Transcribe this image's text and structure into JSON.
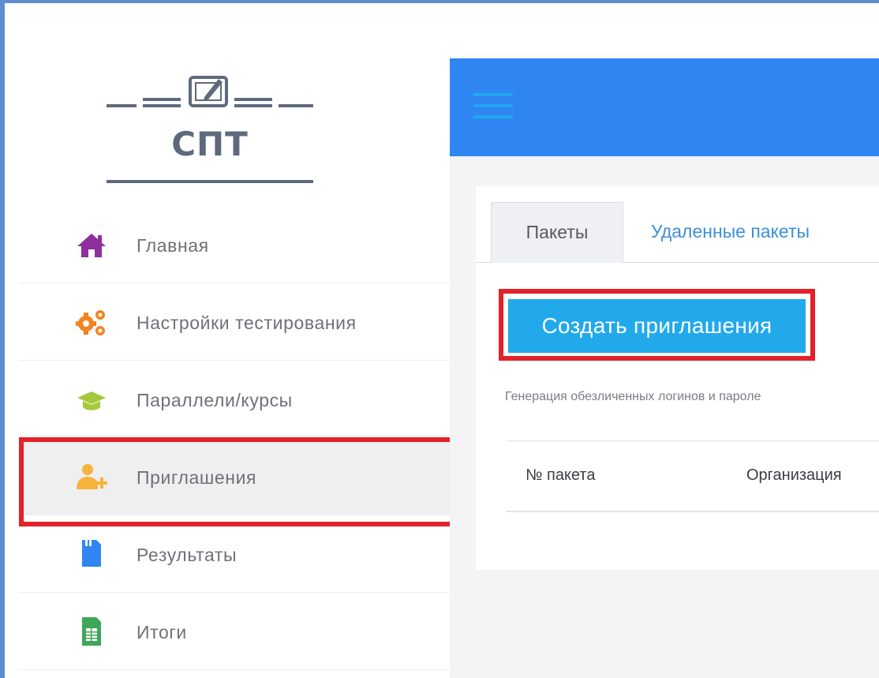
{
  "logo": {
    "text": "СПТ",
    "icon": "drawing-tablet-icon"
  },
  "sidebar": {
    "items": [
      {
        "label": "Главная",
        "icon": "home-icon",
        "color": "#8e2f9e"
      },
      {
        "label": "Настройки тестирования",
        "icon": "gears-icon",
        "color": "#f4831f"
      },
      {
        "label": "Параллели/курсы",
        "icon": "graduation-cap-icon",
        "color": "#a8c83c"
      },
      {
        "label": "Приглашения",
        "icon": "add-user-icon",
        "color": "#f6b33c",
        "active": true
      },
      {
        "label": "Результаты",
        "icon": "document-icon",
        "color": "#2f86f3"
      },
      {
        "label": "Итоги",
        "icon": "spreadsheet-icon",
        "color": "#3ea65b"
      }
    ]
  },
  "topbar": {
    "menu_icon": "hamburger-menu-icon",
    "color": "#2f86f3"
  },
  "tabs": [
    {
      "label": "Пакеты",
      "active": true
    },
    {
      "label": "Удаленные пакеты",
      "active": false
    }
  ],
  "main": {
    "create_button": "Создать приглашения",
    "description": "Генерация обезличенных логинов и пароле",
    "table_headers": [
      "№ пакета",
      "Организация"
    ]
  },
  "colors": {
    "highlight": "#e3222b",
    "button": "#21a9ec",
    "link": "#3d8fd9"
  }
}
